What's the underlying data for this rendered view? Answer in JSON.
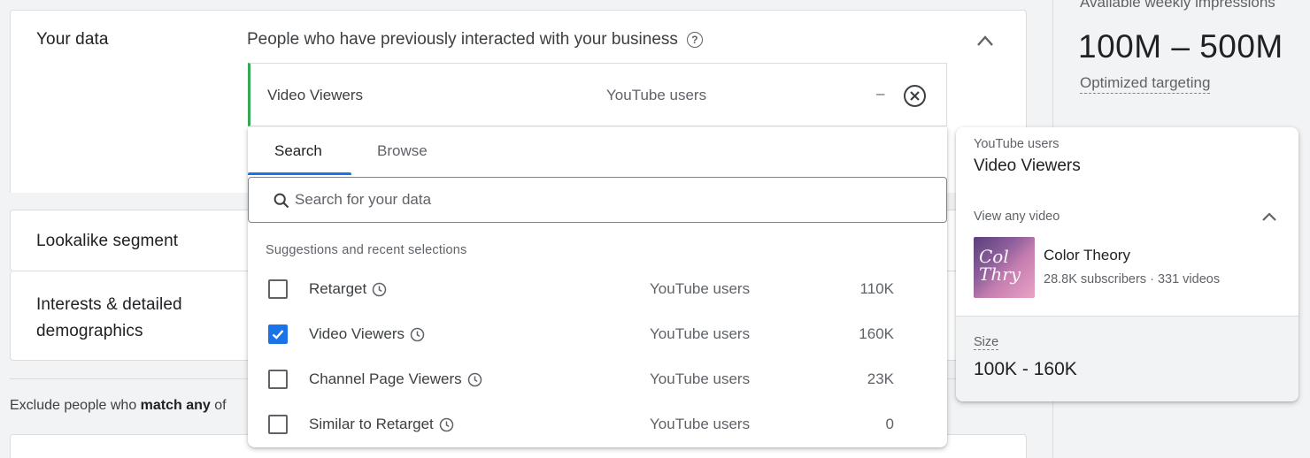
{
  "sidebar": {
    "available_label": "Available weekly impressions",
    "available_value": "100M – 500M",
    "optimized_link": "Optimized targeting"
  },
  "your_data": {
    "title": "Your data",
    "heading": "People who have previously interacted with your business",
    "selected": {
      "name": "Video Viewers",
      "type": "YouTube users",
      "size": "–"
    }
  },
  "sections": {
    "lookalike": "Lookalike segment",
    "interests": "Interests & detailed demographics"
  },
  "exclude": {
    "prefix": "Exclude people who ",
    "bold": "match any",
    "suffix": " of"
  },
  "dropdown": {
    "tabs": [
      {
        "label": "Search",
        "active": true
      },
      {
        "label": "Browse",
        "active": false
      }
    ],
    "search_placeholder": "Search for your data",
    "suggestions_heading": "Suggestions and recent selections",
    "options": [
      {
        "name": "Retarget",
        "type": "YouTube users",
        "size": "110K",
        "checked": false
      },
      {
        "name": "Video Viewers",
        "type": "YouTube users",
        "size": "160K",
        "checked": true
      },
      {
        "name": "Channel Page Viewers",
        "type": "YouTube users",
        "size": "23K",
        "checked": false
      },
      {
        "name": "Similar to Retarget",
        "type": "YouTube users",
        "size": "0",
        "checked": false
      }
    ]
  },
  "detail_card": {
    "type": "YouTube users",
    "name": "Video Viewers",
    "view_label": "View any video",
    "channel": {
      "name": "Color Theory",
      "subscribers": "28.8K subscribers",
      "videos": "331 videos",
      "thumb_text": "Col Thry"
    },
    "size_label": "Size",
    "size_value": "100K - 160K"
  },
  "colors": {
    "accent": "#1a73e8",
    "selected_bar": "#34a853"
  }
}
